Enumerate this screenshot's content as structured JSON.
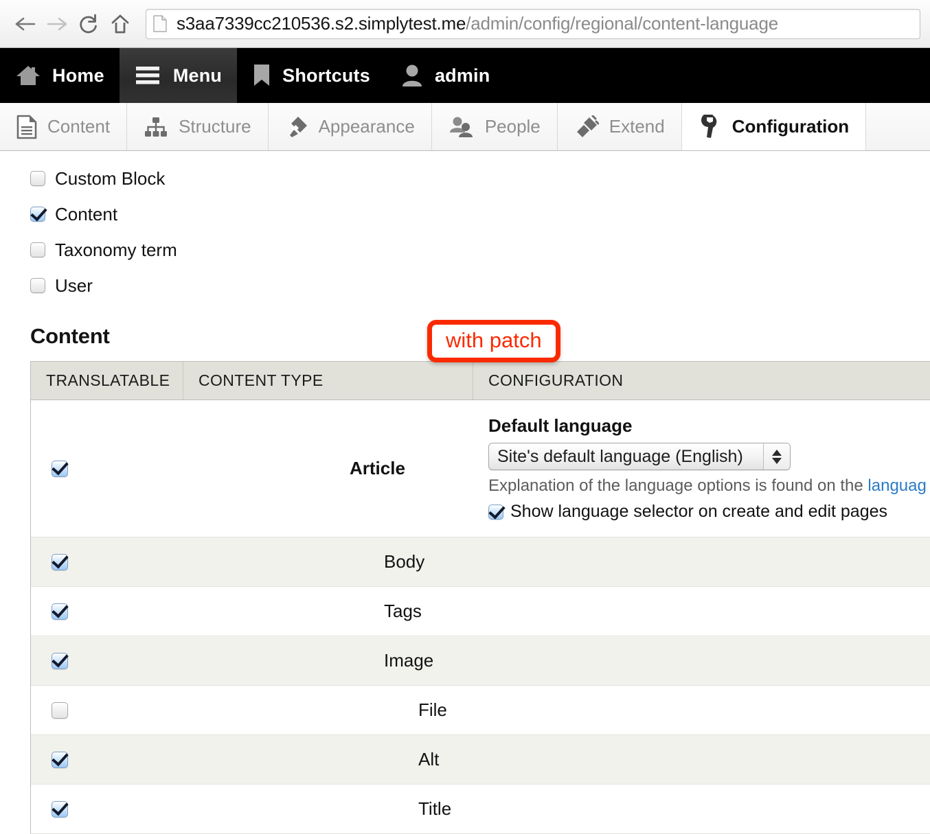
{
  "browser": {
    "back_icon": "back-arrow-icon",
    "forward_icon": "forward-arrow-icon",
    "reload_icon": "reload-icon",
    "home_icon": "home-icon",
    "page_icon": "page-document-icon",
    "url_host": "s3aa7339cc210536.s2.simplytest.me",
    "url_path": "/admin/config/regional/content-language"
  },
  "toolbar": {
    "items": [
      {
        "label": "Home",
        "icon": "house-icon",
        "active": false
      },
      {
        "label": "Menu",
        "icon": "hamburger-icon",
        "active": true
      },
      {
        "label": "Shortcuts",
        "icon": "bookmark-icon",
        "active": false
      },
      {
        "label": "admin",
        "icon": "user-icon",
        "active": false
      }
    ]
  },
  "admin_nav": {
    "items": [
      {
        "label": "Content",
        "icon": "document-icon",
        "active": false
      },
      {
        "label": "Structure",
        "icon": "sitemap-icon",
        "active": false
      },
      {
        "label": "Appearance",
        "icon": "paintbrush-icon",
        "active": false
      },
      {
        "label": "People",
        "icon": "people-icon",
        "active": false
      },
      {
        "label": "Extend",
        "icon": "plug-icon",
        "active": false
      },
      {
        "label": "Configuration",
        "icon": "wrench-icon",
        "active": true
      }
    ]
  },
  "annotation": {
    "text": "with patch",
    "color": "#fa2a00"
  },
  "entity_types": [
    {
      "label": "Custom Block",
      "checked": false
    },
    {
      "label": "Content",
      "checked": true
    },
    {
      "label": "Taxonomy term",
      "checked": false
    },
    {
      "label": "User",
      "checked": false
    }
  ],
  "content_section": {
    "title": "Content",
    "table": {
      "headers": [
        "TRANSLATABLE",
        "CONTENT TYPE",
        "CONFIGURATION"
      ],
      "content_type_row": {
        "checked": true,
        "name": "Article",
        "config": {
          "default_language_label": "Default language",
          "select_value": "Site's default language (English)",
          "description_prefix": "Explanation of the language options is found on the ",
          "description_link": "languag",
          "show_selector_label": "Show language selector on create and edit pages",
          "show_selector_checked": true
        }
      },
      "field_rows": [
        {
          "label": "Body",
          "checked": true,
          "level": 1,
          "stripe": true
        },
        {
          "label": "Tags",
          "checked": true,
          "level": 1,
          "stripe": false
        },
        {
          "label": "Image",
          "checked": true,
          "level": 1,
          "stripe": true
        },
        {
          "label": "File",
          "checked": false,
          "level": 2,
          "stripe": false
        },
        {
          "label": "Alt",
          "checked": true,
          "level": 2,
          "stripe": true
        },
        {
          "label": "Title",
          "checked": true,
          "level": 2,
          "stripe": false
        }
      ]
    }
  }
}
